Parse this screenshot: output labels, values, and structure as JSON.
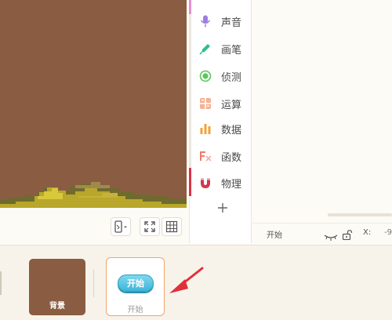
{
  "categories": [
    {
      "label": "声音",
      "icon": "microphone-icon",
      "color": "#a07de0"
    },
    {
      "label": "画笔",
      "icon": "pen-icon",
      "color": "#2fbf8a"
    },
    {
      "label": "侦测",
      "icon": "sensing-icon",
      "color": "#5cc85c"
    },
    {
      "label": "运算",
      "icon": "operators-icon",
      "color": "#f0a27a"
    },
    {
      "label": "数据",
      "icon": "data-icon",
      "color": "#f2a23a"
    },
    {
      "label": "函数",
      "icon": "function-icon",
      "color": "#f07a6a"
    },
    {
      "label": "物理",
      "icon": "magnet-icon",
      "color": "#d8334a"
    }
  ],
  "add_category_icon": "plus-icon",
  "stage_tools": [
    "phone-mode-icon",
    "fullscreen-icon",
    "grid-icon"
  ],
  "status": {
    "sprite_name": "开始",
    "x_label": "X:",
    "x_value": "-9"
  },
  "tray": {
    "background_label": "背景",
    "sprite_button_text": "开始",
    "sprite_name": "开始"
  },
  "colors": {
    "stage_background": "#8a5c42",
    "accent_selected": "#f2a46a",
    "start_button": "#3fb6da",
    "annotation_arrow": "#e0303a"
  }
}
